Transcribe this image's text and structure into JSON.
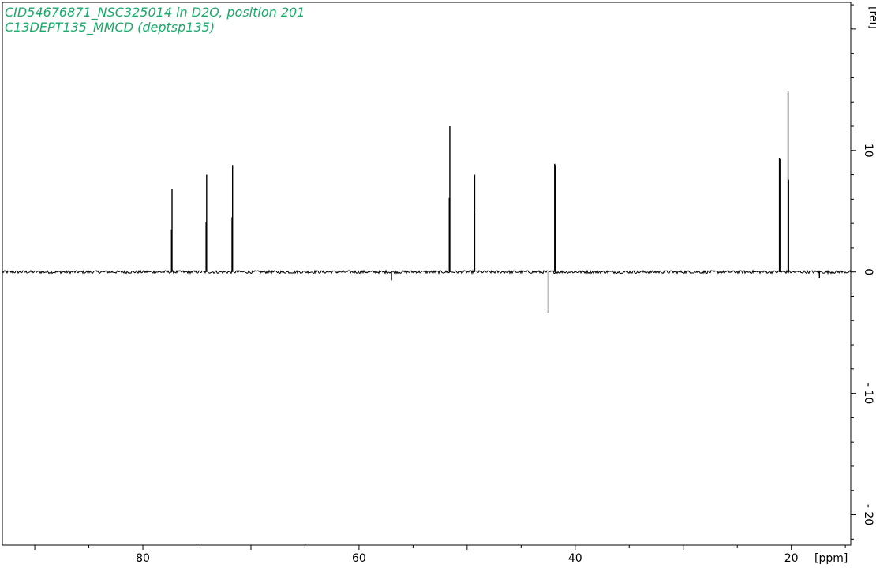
{
  "title_lines": [
    "CID54676871_NSC325014 in D2O, position 201",
    "C13DEPT135_MMCD (deptsp135)"
  ],
  "colors": {
    "title": "#1aaa6a",
    "trace": "#000000",
    "frame": "#000000"
  },
  "chart_data": {
    "type": "line",
    "title": "",
    "xlabel": "",
    "ylabel": "",
    "x_unit": "[ppm]",
    "y_unit": "[rel]",
    "xlim": [
      93.0,
      14.5
    ],
    "x_reversed": true,
    "ylim": [
      -22.5,
      22.2
    ],
    "x_ticks": [
      80,
      60,
      40,
      20
    ],
    "y_ticks": [
      10,
      0,
      -10,
      -20
    ],
    "grid": false,
    "noise_level": 0.12,
    "peaks": [
      {
        "x": 77.3,
        "y": 6.8
      },
      {
        "x": 77.35,
        "y": 3.5
      },
      {
        "x": 74.1,
        "y": 8.0
      },
      {
        "x": 74.15,
        "y": 4.1
      },
      {
        "x": 71.7,
        "y": 8.8
      },
      {
        "x": 71.75,
        "y": 4.5
      },
      {
        "x": 57.0,
        "y": -0.7
      },
      {
        "x": 51.6,
        "y": 12.0
      },
      {
        "x": 51.65,
        "y": 6.1
      },
      {
        "x": 49.3,
        "y": 8.0
      },
      {
        "x": 49.35,
        "y": 5.0
      },
      {
        "x": 42.5,
        "y": -3.4
      },
      {
        "x": 41.9,
        "y": 8.9
      },
      {
        "x": 41.8,
        "y": 8.8
      },
      {
        "x": 21.1,
        "y": 9.4
      },
      {
        "x": 21.0,
        "y": 9.3
      },
      {
        "x": 20.3,
        "y": 14.9
      },
      {
        "x": 20.25,
        "y": 7.6
      },
      {
        "x": 17.4,
        "y": -0.5
      }
    ]
  }
}
